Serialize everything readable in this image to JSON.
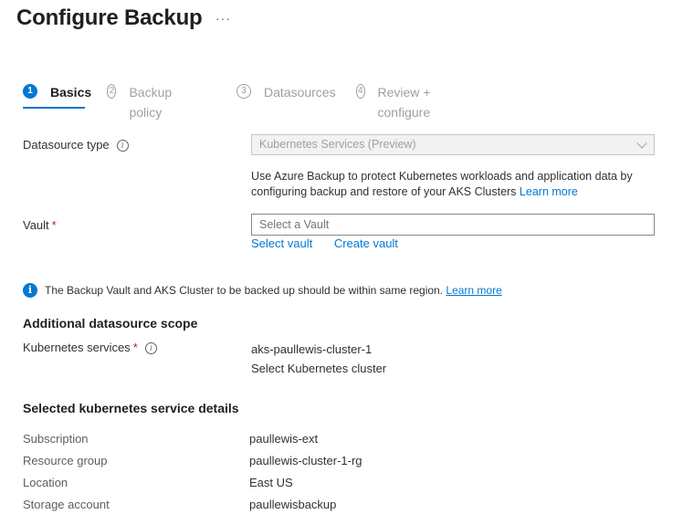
{
  "header": {
    "title": "Configure Backup",
    "more": "···"
  },
  "steps": [
    {
      "num": "1",
      "label": "Basics",
      "active": true
    },
    {
      "num": "2",
      "label": "Backup policy",
      "active": false
    },
    {
      "num": "3",
      "label": "Datasources",
      "active": false
    },
    {
      "num": "4",
      "label": "Review + configure",
      "active": false
    }
  ],
  "datasource": {
    "label": "Datasource type",
    "value": "Kubernetes Services (Preview)",
    "description": "Use Azure Backup to protect Kubernetes workloads and application data by configuring backup and restore of your AKS Clusters",
    "learn_more": "Learn more"
  },
  "vault": {
    "label": "Vault",
    "required": "*",
    "placeholder": "Select a Vault",
    "select_link": "Select vault",
    "create_link": "Create vault"
  },
  "info_message": {
    "text": "The Backup Vault and AKS Cluster to be backed up should be within same region.",
    "link": "Learn more"
  },
  "scope": {
    "title": "Additional datasource scope",
    "label": "Kubernetes services",
    "required": "*",
    "value": "aks-paullewis-cluster-1",
    "select_link": "Select Kubernetes cluster"
  },
  "details": {
    "title": "Selected kubernetes service details",
    "rows": [
      {
        "label": "Subscription",
        "value": "paullewis-ext"
      },
      {
        "label": "Resource group",
        "value": "paullewis-cluster-1-rg"
      },
      {
        "label": "Location",
        "value": "East US"
      },
      {
        "label": "Storage account",
        "value": "paullewisbackup"
      }
    ]
  },
  "colors": {
    "accent": "#0078d4",
    "required": "#a4262c"
  }
}
